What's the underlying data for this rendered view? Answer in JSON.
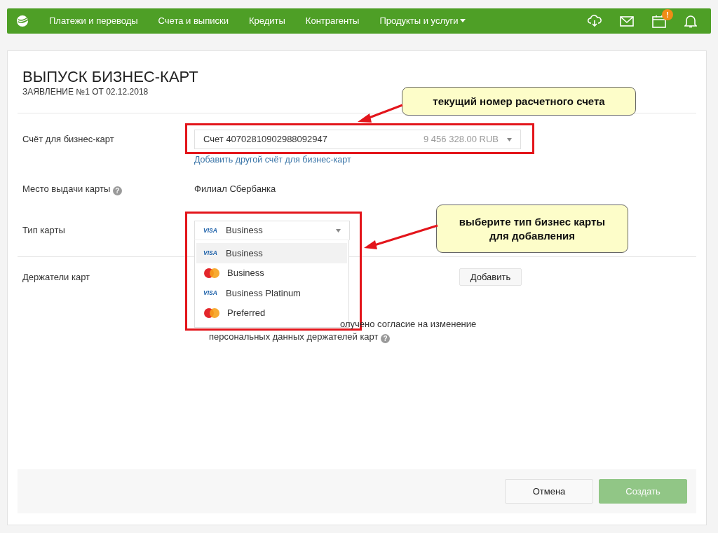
{
  "navbar": {
    "items": [
      {
        "label": "Платежи и переводы",
        "dropdown": false
      },
      {
        "label": "Счета и выписки",
        "dropdown": false
      },
      {
        "label": "Кредиты",
        "dropdown": false
      },
      {
        "label": "Контрагенты",
        "dropdown": false
      },
      {
        "label": "Продукты и услуги",
        "dropdown": true
      }
    ],
    "calendar_badge": "!"
  },
  "form": {
    "title": "ВЫПУСК БИЗНЕС-КАРТ",
    "subtitle": "ЗАЯВЛЕНИЕ №1 ОТ 02.12.2018",
    "account": {
      "label": "Счёт для бизнес-карт",
      "value": "Счет 40702810902988092947",
      "balance": "9 456 328.00 RUB",
      "link": "Добавить другой счёт для бизнес-карт"
    },
    "place": {
      "label": "Место выдачи карты",
      "help_icon": "?",
      "value": "Филиал Сбербанка"
    },
    "card_type": {
      "label": "Тип карты",
      "expanded": true,
      "value": {
        "kind": "visa",
        "logo_text": "VISA",
        "label": "Business"
      },
      "options": [
        {
          "kind": "visa",
          "logo_text": "VISA",
          "label": "Business",
          "selected": true
        },
        {
          "kind": "mastercard",
          "label": "Business",
          "selected": false
        },
        {
          "kind": "visa",
          "logo_text": "VISA",
          "label": "Business Platinum",
          "selected": false
        },
        {
          "kind": "mastercard",
          "label": "Preferred",
          "selected": false
        }
      ]
    },
    "holders": {
      "label": "Держатели карт",
      "button": "Добавить"
    },
    "consent": {
      "lines": [
        "олучено согласие на изменение",
        "персональных данных держателей карт"
      ],
      "help_icon": "?"
    }
  },
  "footer": {
    "buttons": [
      {
        "label": "Отмена",
        "kind": "secondary",
        "disabled": false
      },
      {
        "label": "Создать",
        "kind": "primary",
        "disabled": true
      }
    ]
  },
  "annotations": [
    {
      "text": "текущий номер расчетного счета"
    },
    {
      "text": "выберите тип бизнес карты для добавления"
    }
  ]
}
